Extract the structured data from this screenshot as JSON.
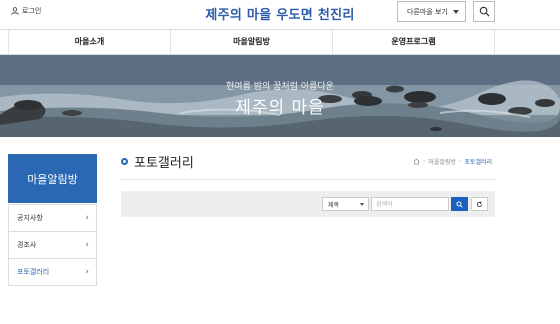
{
  "header": {
    "login_label": "로그인",
    "site_title": "제주의 마을 우도면 천진리",
    "other_village_label": "다른마을 보기",
    "search_icon": "search-icon"
  },
  "gnb": {
    "items": [
      {
        "label": "마을소개"
      },
      {
        "label": "마을알림방"
      },
      {
        "label": "운영프로그램"
      }
    ]
  },
  "banner": {
    "subtitle": "현여름 밤의 꿈처럼 아름다운",
    "title": "제주의 마을"
  },
  "sidebar": {
    "heading": "마을알림방",
    "items": [
      {
        "label": "공지사항",
        "active": false
      },
      {
        "label": "경조사",
        "active": false
      },
      {
        "label": "포토갤러리",
        "active": true
      }
    ]
  },
  "content": {
    "title": "포토갤러리",
    "breadcrumb": {
      "home_icon": "home-icon",
      "items": [
        "마을알림방",
        "포토갤러리"
      ]
    }
  },
  "search": {
    "field_selected": "제목",
    "input_value": "",
    "input_placeholder": "검색어",
    "submit_icon": "search-icon",
    "reset_icon": "refresh-icon"
  },
  "colors": {
    "brand_blue": "#2a68b3",
    "title_blue": "#2b5ba8",
    "button_blue": "#1c5fbd"
  }
}
